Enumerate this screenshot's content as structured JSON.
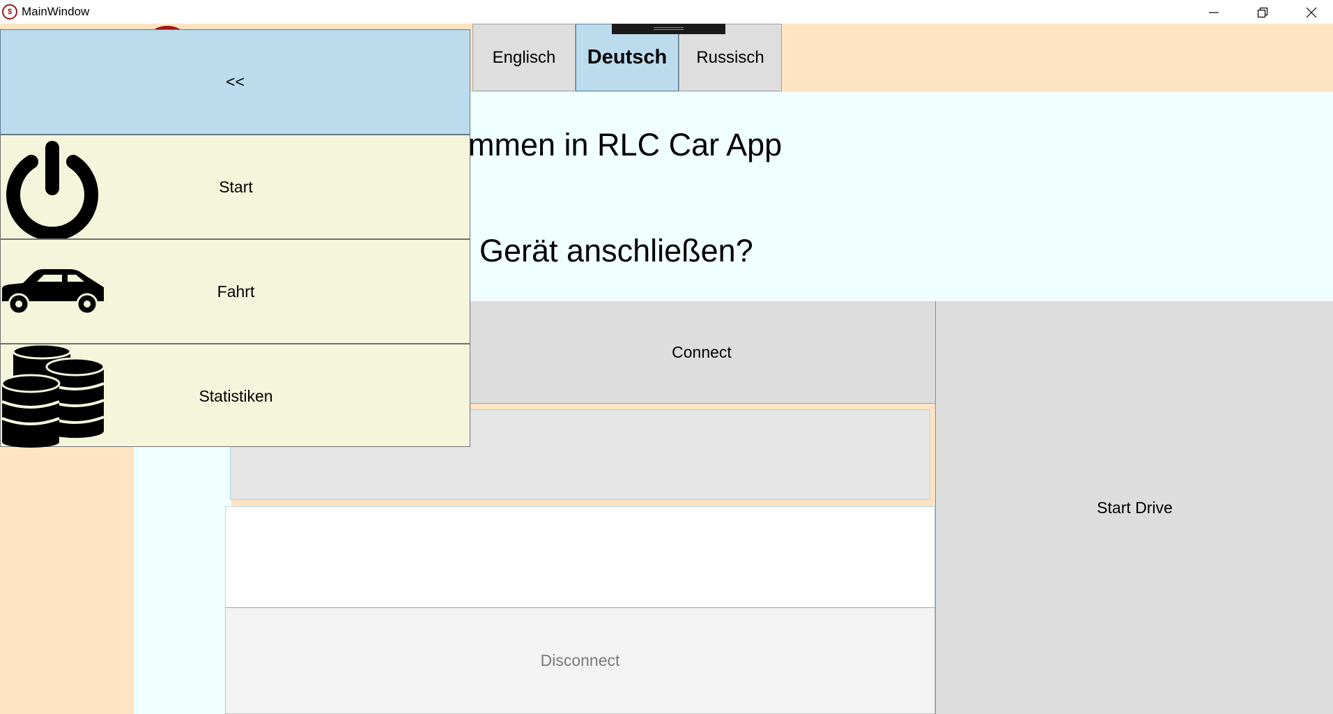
{
  "window": {
    "title": "MainWindow",
    "app_icon_text": "$"
  },
  "languages": {
    "items": [
      {
        "label": "Englisch",
        "active": false
      },
      {
        "label": "Deutsch",
        "active": true
      },
      {
        "label": "Russisch",
        "active": false
      }
    ]
  },
  "main": {
    "welcome_text": "mmen in RLC Car App",
    "question_text": "Gerät anschließen?",
    "connect_label": "Connect",
    "start_drive_label": "Start Drive",
    "disconnect_label": "Disconnect",
    "input_value": ""
  },
  "menu": {
    "toggle_label": "<<",
    "items": [
      {
        "label": "Start",
        "icon": "power-icon"
      },
      {
        "label": "Fahrt",
        "icon": "car-icon"
      },
      {
        "label": "Statistiken",
        "icon": "coins-icon"
      }
    ]
  },
  "colors": {
    "peach_background": "#ffe4c4",
    "azure_background": "#f0ffff",
    "menu_item_background": "#f5f5dc",
    "active_tab": "#bcdbed",
    "button_gray": "#dddddd"
  }
}
